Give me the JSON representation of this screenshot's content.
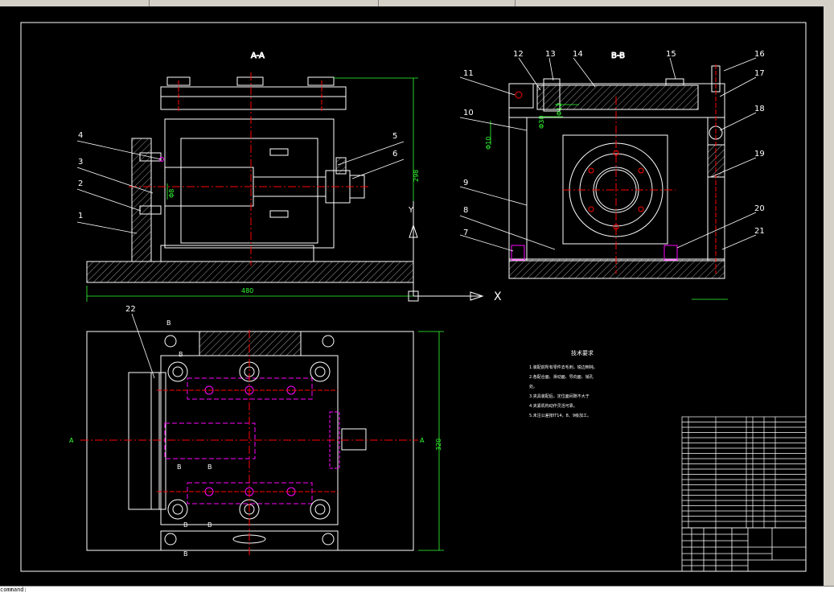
{
  "command_line": {
    "text": "command:"
  },
  "views": {
    "section_a": {
      "title": "A-A"
    },
    "section_b": {
      "title": "B-B"
    }
  },
  "dimensions": {
    "width_480": "480",
    "height_298": "298",
    "width_320": "320",
    "fit_30": "Φ30",
    "fit_12": "Φ12",
    "fit_8": "Φ8",
    "fit_10": "Φ10"
  },
  "part_numbers": [
    "1",
    "2",
    "3",
    "4",
    "5",
    "6",
    "7",
    "8",
    "9",
    "10",
    "11",
    "12",
    "13",
    "14",
    "15",
    "16",
    "17",
    "18",
    "19",
    "20",
    "21",
    "22"
  ],
  "plan_labels": {
    "a_left": "A",
    "a_right": "A",
    "b_top": "B",
    "b_top2": "B",
    "b_mid_left": "B",
    "b_mid_right": "B",
    "b_low_left": "B",
    "b_low_right": "B",
    "b_bottom": "B"
  },
  "ucs": {
    "x": "X",
    "y": "Y"
  },
  "notes": {
    "title": "技术要求",
    "lines": [
      "1.装配前所有零件去毛刺，锐边倒钝。",
      "2.各配合面、滑动面、导向面、销孔",
      "处。",
      "3.夹具装配后，定位面间隙不大于",
      "4.夹紧机构动作灵活可靠。",
      "5.未注公差按IT14，8、9级加工。"
    ]
  },
  "colors": {
    "background": "#000000",
    "outline": "#ffffff",
    "centerline": "#ff0000",
    "dimension": "#00ff00",
    "hidden": "#ff00ff",
    "ui_chrome": "#d4d0c8"
  }
}
